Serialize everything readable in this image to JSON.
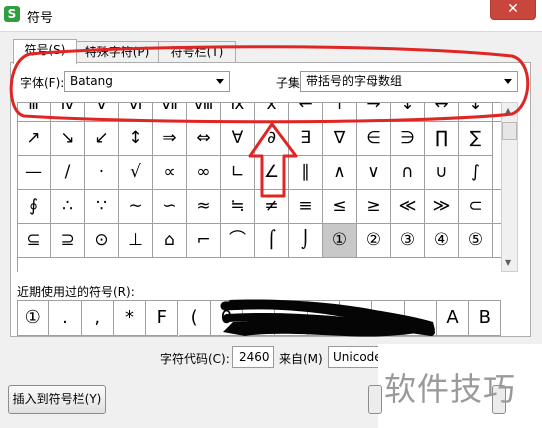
{
  "window": {
    "title": "符号",
    "app_icon_glyph": "S",
    "close_glyph": "✕"
  },
  "tabs": [
    {
      "label": "符号(S)",
      "active": true
    },
    {
      "label": "特殊字符(P)",
      "active": false
    },
    {
      "label": "符号栏(T)",
      "active": false
    }
  ],
  "font": {
    "label": "字体(F):",
    "value": "Batang"
  },
  "subset": {
    "label": "子集(U):",
    "value": "带括号的字母数组"
  },
  "grid": {
    "rows": [
      [
        "ⅲ",
        "ⅳ",
        "ⅴ",
        "ⅵ",
        "ⅶ",
        "ⅷ",
        "ⅸ",
        "ⅹ",
        "←",
        "↑",
        "→",
        "↓",
        "↔",
        "↕",
        "↖"
      ],
      [
        "↗",
        "↘",
        "↙",
        "↕",
        "⇒",
        "⇔",
        "∀",
        "∂",
        "∃",
        "∇",
        "∈",
        "∋",
        "∏",
        "∑"
      ],
      [
        "—",
        "/",
        "·",
        "√",
        "∝",
        "∞",
        "∟",
        "∠",
        "∥",
        "∧",
        "∨",
        "∩",
        "∪",
        "∫",
        "∬"
      ],
      [
        "∮",
        "∴",
        "∵",
        "∼",
        "∽",
        "≈",
        "≒",
        "≠",
        "≡",
        "≤",
        "≥",
        "≪",
        "≫",
        "⊂",
        "⊃"
      ],
      [
        "⊆",
        "⊇",
        "⊙",
        "⊥",
        "⌂",
        "⌐",
        "⌒",
        "⌠",
        "⌡",
        "①",
        "②",
        "③",
        "④",
        "⑤",
        "⑥"
      ]
    ],
    "selected": {
      "row": 4,
      "col": 9
    }
  },
  "recent": {
    "label": "近期使用过的符号(R):",
    "symbols": [
      "①",
      ".",
      ",",
      "*",
      "F",
      "(",
      "0",
      "",
      "",
      "",
      "",
      "",
      "",
      "A",
      "B"
    ]
  },
  "char_code": {
    "label": "字符代码(C):",
    "value": "2460"
  },
  "from": {
    "label": "来自(M)",
    "value": "Unicode"
  },
  "insert_button": {
    "label": "插入到符号栏(Y)"
  },
  "watermark": {
    "text": "软件技巧"
  },
  "colors": {
    "annotation": "#e02525",
    "selected_cell": "#c8c8c8",
    "close_button": "#c9463d",
    "icon": "#2e9e3e"
  }
}
